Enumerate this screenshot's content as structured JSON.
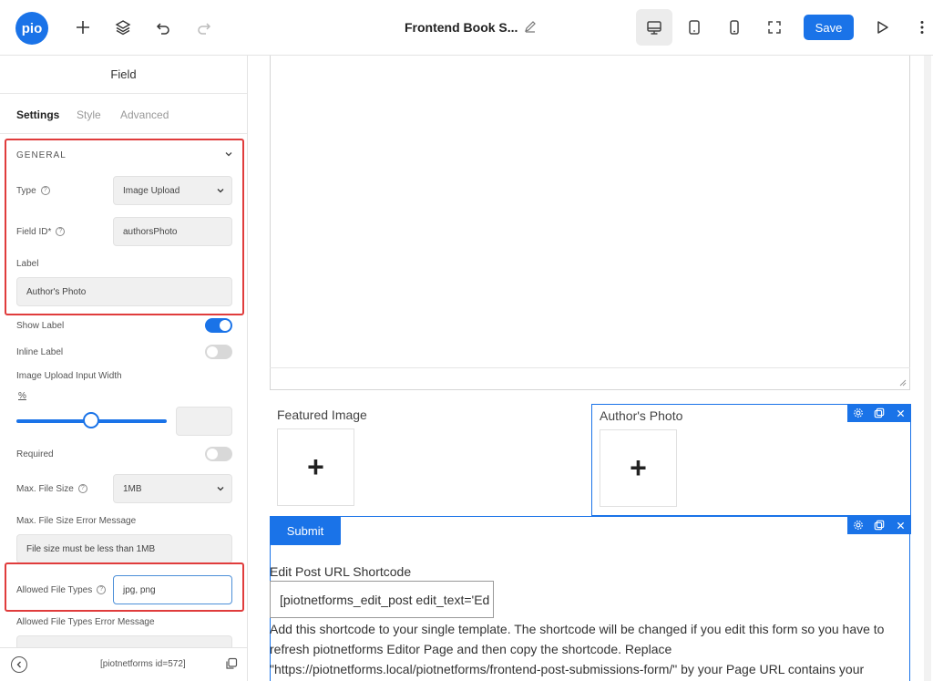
{
  "toolbar": {
    "logo_text": "pio",
    "document_title": "Frontend Book S...",
    "save_label": "Save",
    "icons": [
      "plus-icon",
      "layers-icon",
      "undo-icon",
      "redo-icon",
      "pencil-icon",
      "desktop-icon",
      "tablet-icon",
      "mobile-icon",
      "fullscreen-icon",
      "preview-play-icon",
      "more-vertical-icon"
    ],
    "accent_color": "#1a73e8"
  },
  "sidebar": {
    "header": "Field",
    "tabs": [
      {
        "label": "Settings",
        "active": true
      },
      {
        "label": "Style",
        "active": false
      },
      {
        "label": "Advanced",
        "active": false
      }
    ],
    "general_section_title": "GENERAL",
    "type_label": "Type",
    "type_value": "Image Upload",
    "field_id_label": "Field ID*",
    "field_id_value": "authorsPhoto",
    "label_label": "Label",
    "label_value": "Author's Photo",
    "show_label_label": "Show Label",
    "show_label_on": true,
    "inline_label_label": "Inline Label",
    "inline_label_on": false,
    "input_width_label": "Image Upload Input Width",
    "input_width_unit": "%",
    "input_width_value": "",
    "required_label": "Required",
    "required_on": false,
    "max_file_size_label": "Max. File Size",
    "max_file_size_value": "1MB",
    "max_file_size_error_label": "Max. File Size Error Message",
    "max_file_size_error_value": "File size must be less than 1MB",
    "allowed_file_types_label": "Allowed File Types",
    "allowed_file_types_value": "jpg, png",
    "allowed_file_types_error_label": "Allowed File Types Error Message",
    "footer_shortcode": "[piotnetforms id=572]",
    "highlight_color": "#e03c3c"
  },
  "canvas": {
    "featured_image_label": "Featured Image",
    "authors_photo_label": "Author's Photo",
    "upload_plus": "+",
    "submit_label": "Submit",
    "shortcode_label": "Edit Post URL Shortcode",
    "shortcode_value": "[piotnetforms_edit_post edit_text='Ed",
    "shortcode_description": "Add this shortcode to your single template. The shortcode will be changed if you edit this form so you have to refresh piotnetforms Editor Page and then copy the shortcode. Replace \"https://piotnetforms.local/piotnetforms/frontend-post-submissions-form/\" by your Page URL contains your"
  }
}
